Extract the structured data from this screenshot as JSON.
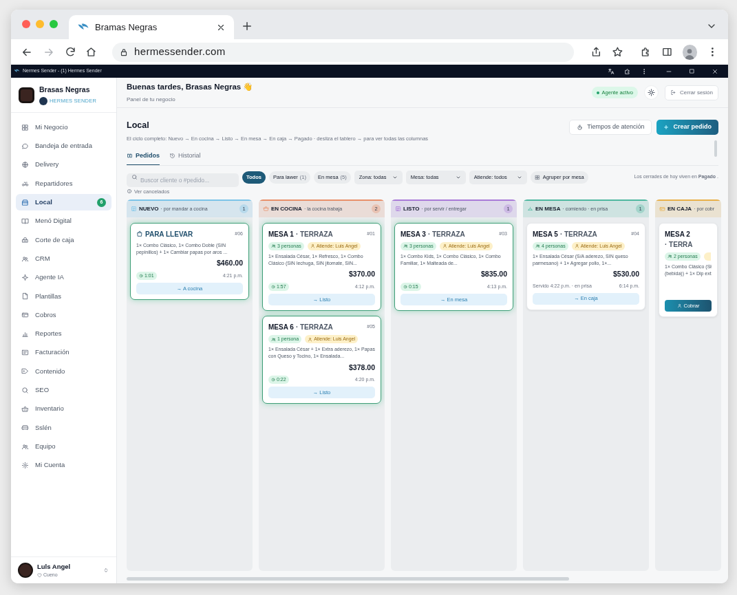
{
  "browser": {
    "tab_title": "Bramas Negras",
    "url": "hermessender.com"
  },
  "app_titlebar": {
    "title": "Nermes Sender - (1) Hermes Sender"
  },
  "sidebar": {
    "brand": "Brasas Negras",
    "brand_sub": "HERMES SENDER",
    "items": [
      {
        "label": "Mi Negocio",
        "selected": false
      },
      {
        "label": "Bandeja de entrada",
        "selected": false
      },
      {
        "label": "Delivery",
        "selected": false
      },
      {
        "label": "Repartidores",
        "selected": false
      },
      {
        "label": "Local",
        "selected": true,
        "badge": "6"
      },
      {
        "label": "Menó Digital",
        "selected": false
      },
      {
        "label": "Corte de caja",
        "selected": false
      },
      {
        "label": "CRM",
        "selected": false
      },
      {
        "label": "Agente IA",
        "selected": false
      },
      {
        "label": "Plantillas",
        "selected": false
      },
      {
        "label": "Cobros",
        "selected": false
      },
      {
        "label": "Reportes",
        "selected": false
      },
      {
        "label": "Facturación",
        "selected": false
      },
      {
        "label": "Contenido",
        "selected": false
      },
      {
        "label": "SEO",
        "selected": false
      },
      {
        "label": "Inventario",
        "selected": false
      },
      {
        "label": "Sslén",
        "selected": false
      },
      {
        "label": "Equipo",
        "selected": false
      },
      {
        "label": "Mi Cuenta",
        "selected": false
      }
    ],
    "user": {
      "name": "Luls Angel",
      "role": "Cueno"
    }
  },
  "header": {
    "greeting": "Buenas tardes, Brasas Negras 👋",
    "subtitle": "Panel de tu negocio",
    "agent_status": "Agente activo",
    "logout": "Cerrar sesión"
  },
  "section": {
    "title": "Local",
    "description": "El ciclo completo: Nuevo → En cocina → Listo → En mesa → En caja → Pagado · desliza el tablero → para ver todas las columnas",
    "buttons": [
      {
        "label": "Tiempos de atención",
        "kind": "secondary"
      },
      {
        "label": "Crear pedido",
        "kind": "primary"
      }
    ]
  },
  "tabs": [
    {
      "label": "Pedidos",
      "selected": true
    },
    {
      "label": "Historial",
      "selected": false
    }
  ],
  "search": {
    "placeholder": "Buscor cliente o #pedido..."
  },
  "filters": [
    {
      "label": "Todos",
      "selected": true
    },
    {
      "label": "Para lawer",
      "count": "(1)",
      "selected": false
    },
    {
      "label": "En mesa",
      "count": "(5)",
      "selected": false
    }
  ],
  "dropdowns": [
    "Zona: todas",
    "Mesa: todas",
    "Atiende: todos"
  ],
  "group_button": "Agruper por mesa",
  "note": "Los cerrades de hoy viven en **Pagado** .",
  "show_cancelled": "Ver cancelados",
  "columns": [
    {
      "title": "NUEVO",
      "subtitle": "· por mandar a cocina",
      "count": "1",
      "color": "#7cc4e8",
      "cards": [
        {
          "kind": "takeaway",
          "title": "PARA LLEVAR",
          "number": "#06",
          "items": "1× Combo Clásico, 1× Combo Doble (SIN pepinillos) + 1× Cambiar papas por aros ...",
          "total": "$460.00",
          "timer": "1:01",
          "time": "4:21 p.m.",
          "action": {
            "label": "→ A cocina",
            "kind": "advance"
          },
          "highlighted": true
        }
      ]
    },
    {
      "title": "EN COCINA",
      "subtitle": "· la cocina trabaja",
      "count": "2",
      "color": "#e8906a",
      "cards": [
        {
          "kind": "table",
          "title": "MESA 1",
          "zone": "· TERRAZA",
          "number": "#01",
          "guests": "3 personas",
          "waiter": "Atiende: Luis Angel",
          "items": "1× Ensalada César, 1× Refresco, 1× Combo Clásico (SIN lechuga, SIN jitomate, SIN...",
          "total": "$370.00",
          "timer": "1:57",
          "time": "4:12 p.m.",
          "action": {
            "label": "→ Listo",
            "kind": "advance"
          },
          "highlighted": true
        },
        {
          "kind": "table",
          "title": "MESA 6",
          "zone": "· TERRAZA",
          "number": "#05",
          "guests": "1 persona",
          "waiter": "Atiende: Luis Angel",
          "items": "1× Ensalada César + 1× Extra aderezo, 1× Papas con Queso y Tocino, 1× Ensalada...",
          "total": "$378.00",
          "timer": "0:22",
          "time": "4:20 p.m.",
          "action": {
            "label": "→ Listo",
            "kind": "advance"
          },
          "highlighted": true
        }
      ]
    },
    {
      "title": "LISTO",
      "subtitle": "· por servir / entregar",
      "count": "1",
      "color": "#a97ad8",
      "cards": [
        {
          "kind": "table",
          "title": "MESA 3",
          "zone": "· TERRAZA",
          "number": "#03",
          "guests": "3 personas",
          "waiter": "Atiende: Luis Angel",
          "items": "1× Combo Kids, 1× Combo Clásico, 1× Combo Familiar, 1× Malteada de...",
          "total": "$835.00",
          "timer": "0:15",
          "time": "4:13 p.m.",
          "action": {
            "label": "→ En mesa",
            "kind": "advance"
          },
          "highlighted": true
        }
      ]
    },
    {
      "title": "EN MESA",
      "subtitle": "· comiendo · en prisa",
      "count": "1",
      "color": "#4fb8a0",
      "cards": [
        {
          "kind": "table",
          "title": "MESA 5",
          "zone": "· TERRAZA",
          "number": "#04",
          "guests": "4 personas",
          "waiter": "Atiende: Luis Angel",
          "items": "1× Ensalada César (S/A aderezo, SIN queso parmesano) + 1× Agregar pollo, 1×...",
          "total": "$530.00",
          "served_note": "Servido 4:22 p.m. · en prisa",
          "time": "6:14 p.m.",
          "action": {
            "label": "→ En caja",
            "kind": "advance"
          },
          "highlighted": false
        }
      ]
    },
    {
      "title": "EN CAJA",
      "subtitle": "· por cobr",
      "color": "#e8b04a",
      "cards": [
        {
          "kind": "table",
          "title": "MESA 2",
          "zone": "· TERRA",
          "guests": "2 personas",
          "items": "1× Combo Clásico (Sł (bebida)) + 1× Dip ext",
          "action": {
            "label": "Cobrar",
            "kind": "charge"
          },
          "highlighted": false
        }
      ]
    }
  ]
}
